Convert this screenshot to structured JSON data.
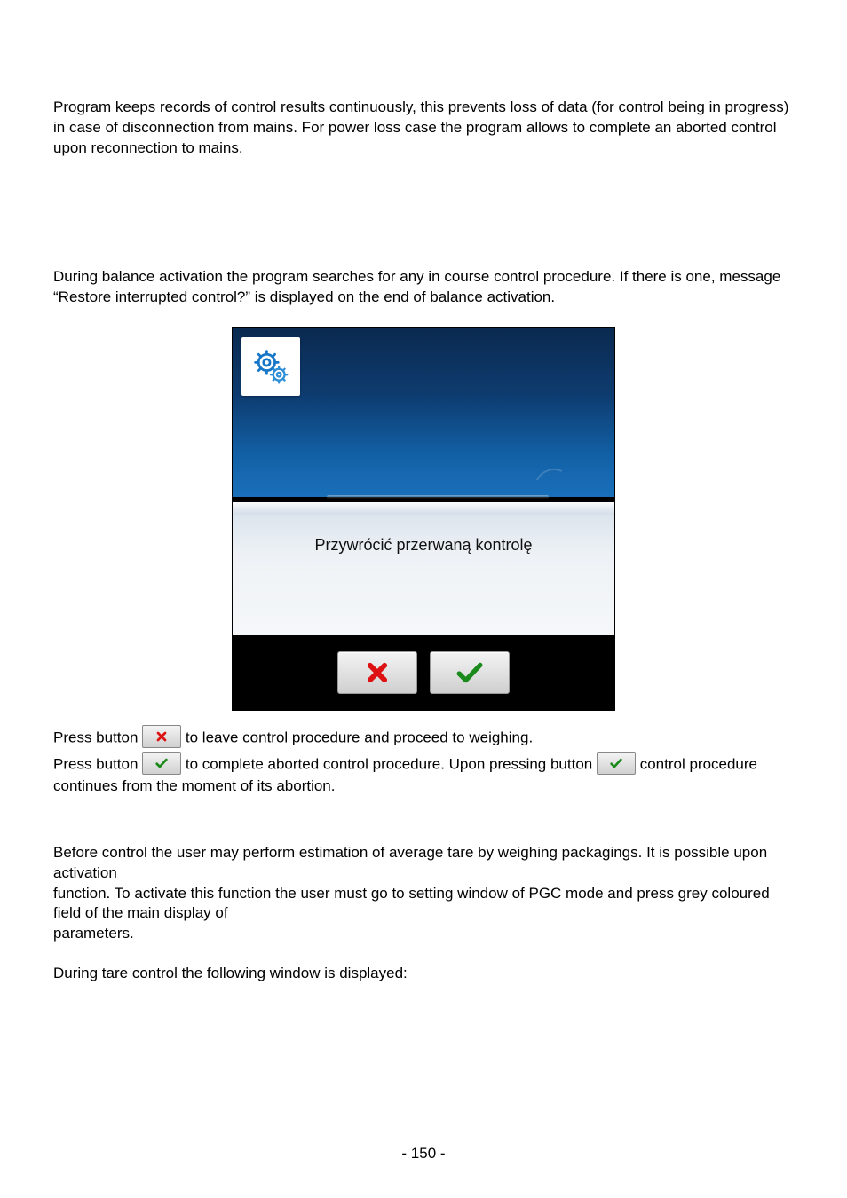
{
  "para1": "Program keeps records of control results continuously, this prevents loss of data (for control being in progress) in case of disconnection from mains. For power loss case the program allows to complete an aborted control upon reconnection to mains.",
  "para2": "During balance activation the program searches for any in course control procedure. If there is one, message “Restore interrupted control?” is displayed on the end of balance activation.",
  "dialog_message": "Przywrócić przerwaną kontrolę",
  "line1_a": "Press button ",
  "line1_b": " to leave control procedure and proceed to weighing.",
  "line2_a": "Press button ",
  "line2_b": " to complete aborted control procedure. Upon pressing button ",
  "line2_c": " control procedure continues from the moment of its abortion.",
  "para3": "Before control the user may perform estimation of average tare by weighing packagings. It is possible upon activation",
  "para3b": "function. To activate this function the user must go to setting window of PGC mode and press grey coloured field of the main display of",
  "para3c": "parameters.",
  "para4": " During tare control the following window is displayed:",
  "page_number": "- 150 -"
}
